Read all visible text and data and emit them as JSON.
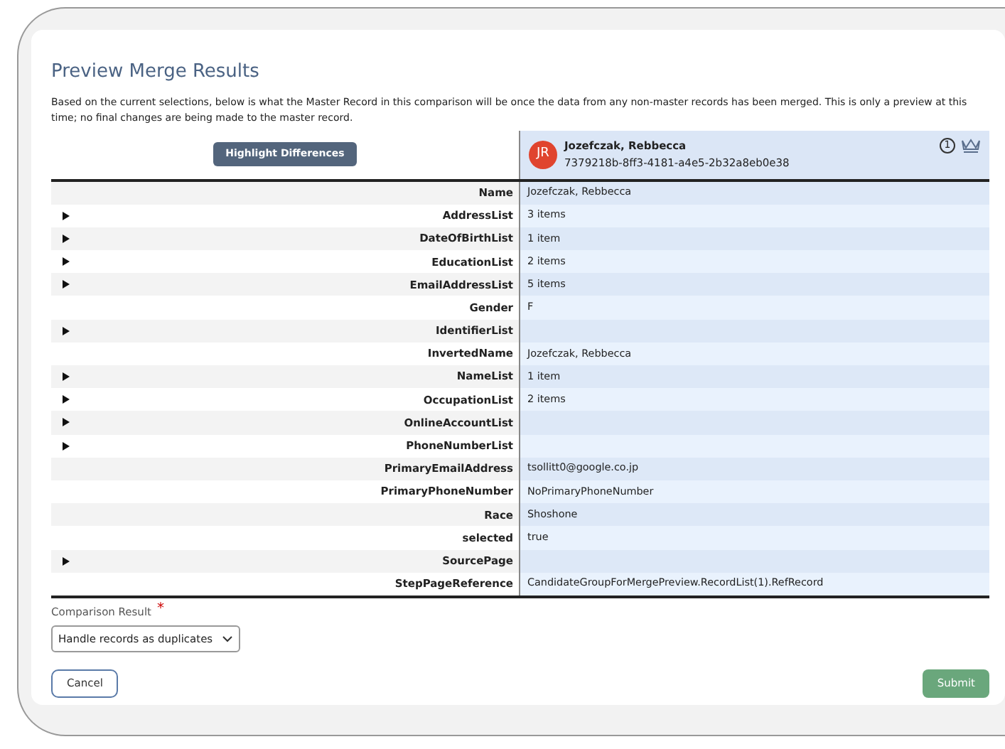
{
  "title": "Preview Merge Results",
  "description": "Based on the current selections, below is what the Master Record in this comparison will be once the data from any non-master records has been merged. This is only a preview at this time; no final changes are being made to the master record.",
  "highlight_button": "Highlight Differences",
  "master": {
    "initials": "JR",
    "name": "Jozefczak, Rebbecca",
    "id": "7379218b-8ff3-4181-a4e5-2b32a8eb0e38",
    "badge": "1"
  },
  "rows": [
    {
      "label": "Name",
      "value": "Jozefczak, Rebbecca",
      "expandable": false
    },
    {
      "label": "AddressList",
      "value": "3 items",
      "expandable": true
    },
    {
      "label": "DateOfBirthList",
      "value": "1 item",
      "expandable": true
    },
    {
      "label": "EducationList",
      "value": "2 items",
      "expandable": true
    },
    {
      "label": "EmailAddressList",
      "value": "5 items",
      "expandable": true
    },
    {
      "label": "Gender",
      "value": "F",
      "expandable": false
    },
    {
      "label": "IdentifierList",
      "value": "",
      "expandable": true
    },
    {
      "label": "InvertedName",
      "value": "Jozefczak, Rebbecca",
      "expandable": false
    },
    {
      "label": "NameList",
      "value": "1 item",
      "expandable": true
    },
    {
      "label": "OccupationList",
      "value": "2 items",
      "expandable": true
    },
    {
      "label": "OnlineAccountList",
      "value": "",
      "expandable": true
    },
    {
      "label": "PhoneNumberList",
      "value": "",
      "expandable": true
    },
    {
      "label": "PrimaryEmailAddress",
      "value": "tsollitt0@google.co.jp",
      "expandable": false
    },
    {
      "label": "PrimaryPhoneNumber",
      "value": "NoPrimaryPhoneNumber",
      "expandable": false
    },
    {
      "label": "Race",
      "value": "Shoshone",
      "expandable": false
    },
    {
      "label": "selected",
      "value": "true",
      "expandable": false
    },
    {
      "label": "SourcePage",
      "value": "",
      "expandable": true
    },
    {
      "label": "StepPageReference",
      "value": "CandidateGroupForMergePreview.RecordList(1).RefRecord",
      "expandable": false
    }
  ],
  "comparison": {
    "label": "Comparison Result",
    "required_mark": "*",
    "value": "Handle records as duplicates"
  },
  "buttons": {
    "cancel": "Cancel",
    "submit": "Submit"
  }
}
